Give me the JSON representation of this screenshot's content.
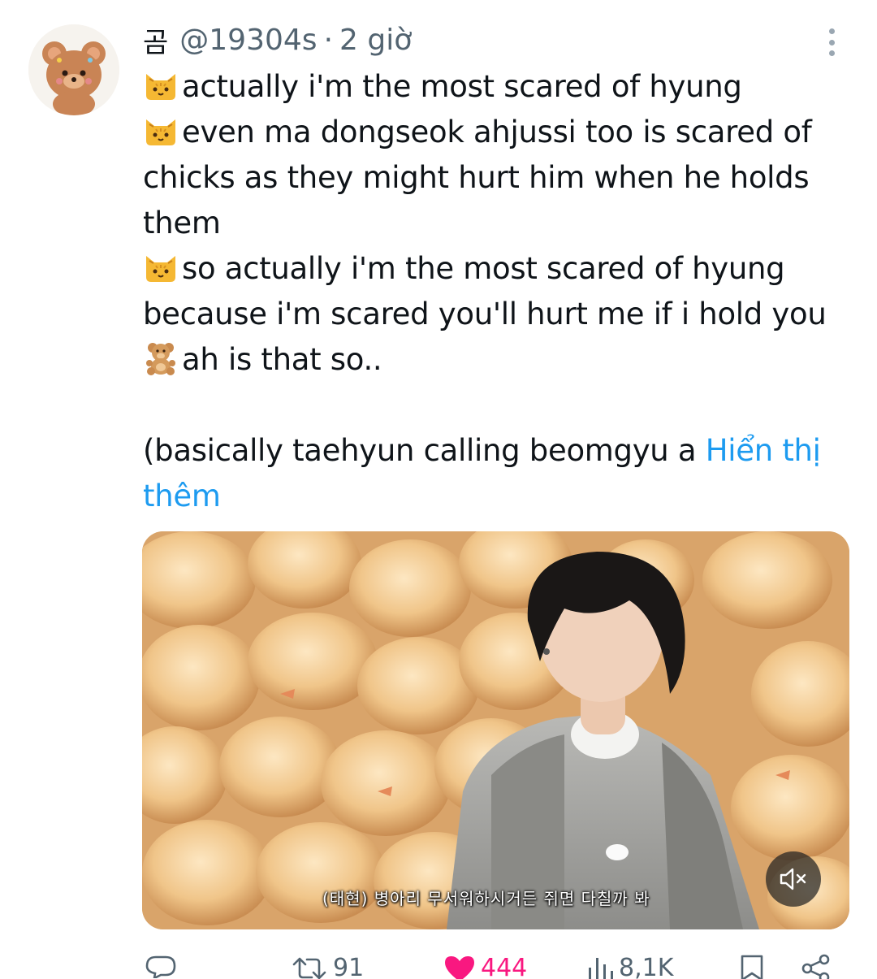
{
  "author": {
    "name": "곰",
    "handle": "@19304s",
    "separator": "·",
    "time": "2 giờ"
  },
  "tweet": {
    "lines": [
      {
        "emoji": "cat-face-emoji",
        "text": "actually i'm the most scared of hyung"
      },
      {
        "emoji": "cat-face-emoji",
        "text": "even ma dongseok ahjussi too is scared of"
      },
      {
        "emoji": "",
        "text": "chicks as they might hurt him when he holds"
      },
      {
        "emoji": "",
        "text": "them"
      },
      {
        "emoji": "cat-face-emoji",
        "text": "so actually i'm the most scared of hyung"
      },
      {
        "emoji": "",
        "text": "because i'm scared you'll hurt me if i hold you"
      },
      {
        "emoji": "teddy-bear-emoji",
        "text": "ah is that so.."
      }
    ],
    "truncated_text": "(basically taehyun calling beomgyu a ",
    "show_more_part1": "Hiển thị",
    "show_more_part2": "thêm"
  },
  "media": {
    "subtitle": "(태현) 병아리 무서워하시거든 쥐면 다칠까 봐",
    "mute_icon": "speaker-muted-icon"
  },
  "actions": {
    "reply": {
      "icon": "reply-icon",
      "count": ""
    },
    "repost": {
      "icon": "repost-icon",
      "count": "91"
    },
    "like": {
      "icon": "heart-filled-icon",
      "count": "444"
    },
    "views": {
      "icon": "views-bar-icon",
      "count": "8,1K"
    },
    "bookmark": {
      "icon": "bookmark-icon"
    },
    "share": {
      "icon": "share-icon"
    }
  },
  "colors": {
    "link": "#1d9bf0",
    "like": "#f91880",
    "muted_text": "#536471",
    "text": "#0f1419"
  }
}
